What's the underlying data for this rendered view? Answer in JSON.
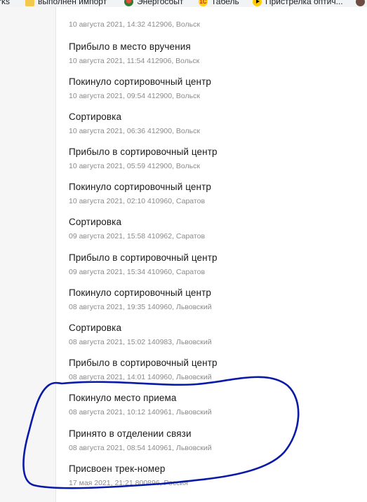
{
  "bookmarks": [
    {
      "label": "rks",
      "icon": "none"
    },
    {
      "label": "выполнен импорт",
      "icon": "folder-icon"
    },
    {
      "label": "Энергосбыт",
      "icon": "energosbyt-icon"
    },
    {
      "label": "Табель",
      "icon": "1c-icon"
    },
    {
      "label": "Пристрелка оптич...",
      "icon": "play-icon"
    },
    {
      "label": "",
      "icon": "extension-icon"
    }
  ],
  "tracking": {
    "events": [
      {
        "title": "",
        "meta": "10 августа 2021, 14:32 412906, Вольск"
      },
      {
        "title": "Прибыло в место вручения",
        "meta": "10 августа 2021, 11:54 412906, Вольск"
      },
      {
        "title": "Покинуло сортировочный центр",
        "meta": "10 августа 2021, 09:54 412900, Вольск"
      },
      {
        "title": "Сортировка",
        "meta": "10 августа 2021, 06:36 412900, Вольск"
      },
      {
        "title": "Прибыло в сортировочный центр",
        "meta": "10 августа 2021, 05:59 412900, Вольск"
      },
      {
        "title": "Покинуло сортировочный центр",
        "meta": "10 августа 2021, 02:10 410960, Саратов"
      },
      {
        "title": "Сортировка",
        "meta": "09 августа 2021, 15:58 410962, Саратов"
      },
      {
        "title": "Прибыло в сортировочный центр",
        "meta": "09 августа 2021, 15:34 410960, Саратов"
      },
      {
        "title": "Покинуло сортировочный центр",
        "meta": "08 августа 2021, 19:35 140960, Львовский"
      },
      {
        "title": "Сортировка",
        "meta": "08 августа 2021, 15:02 140983, Львовский"
      },
      {
        "title": "Прибыло в сортировочный центр",
        "meta": "08 августа 2021, 14:01 140960, Львовский"
      },
      {
        "title": "Покинуло место приема",
        "meta": "08 августа 2021, 10:12 140961, Львовский"
      },
      {
        "title": "Принято в отделении связи",
        "meta": "08 августа 2021, 08:54 140961, Львовский"
      },
      {
        "title": "Присвоен трек-номер",
        "meta": "17 мая 2021, 21:21 800896, Россия"
      }
    ]
  },
  "colors": {
    "annotation_stroke": "#0a1aa8",
    "meta_text": "#8a8a8a",
    "title_text": "#1a1a1a"
  }
}
